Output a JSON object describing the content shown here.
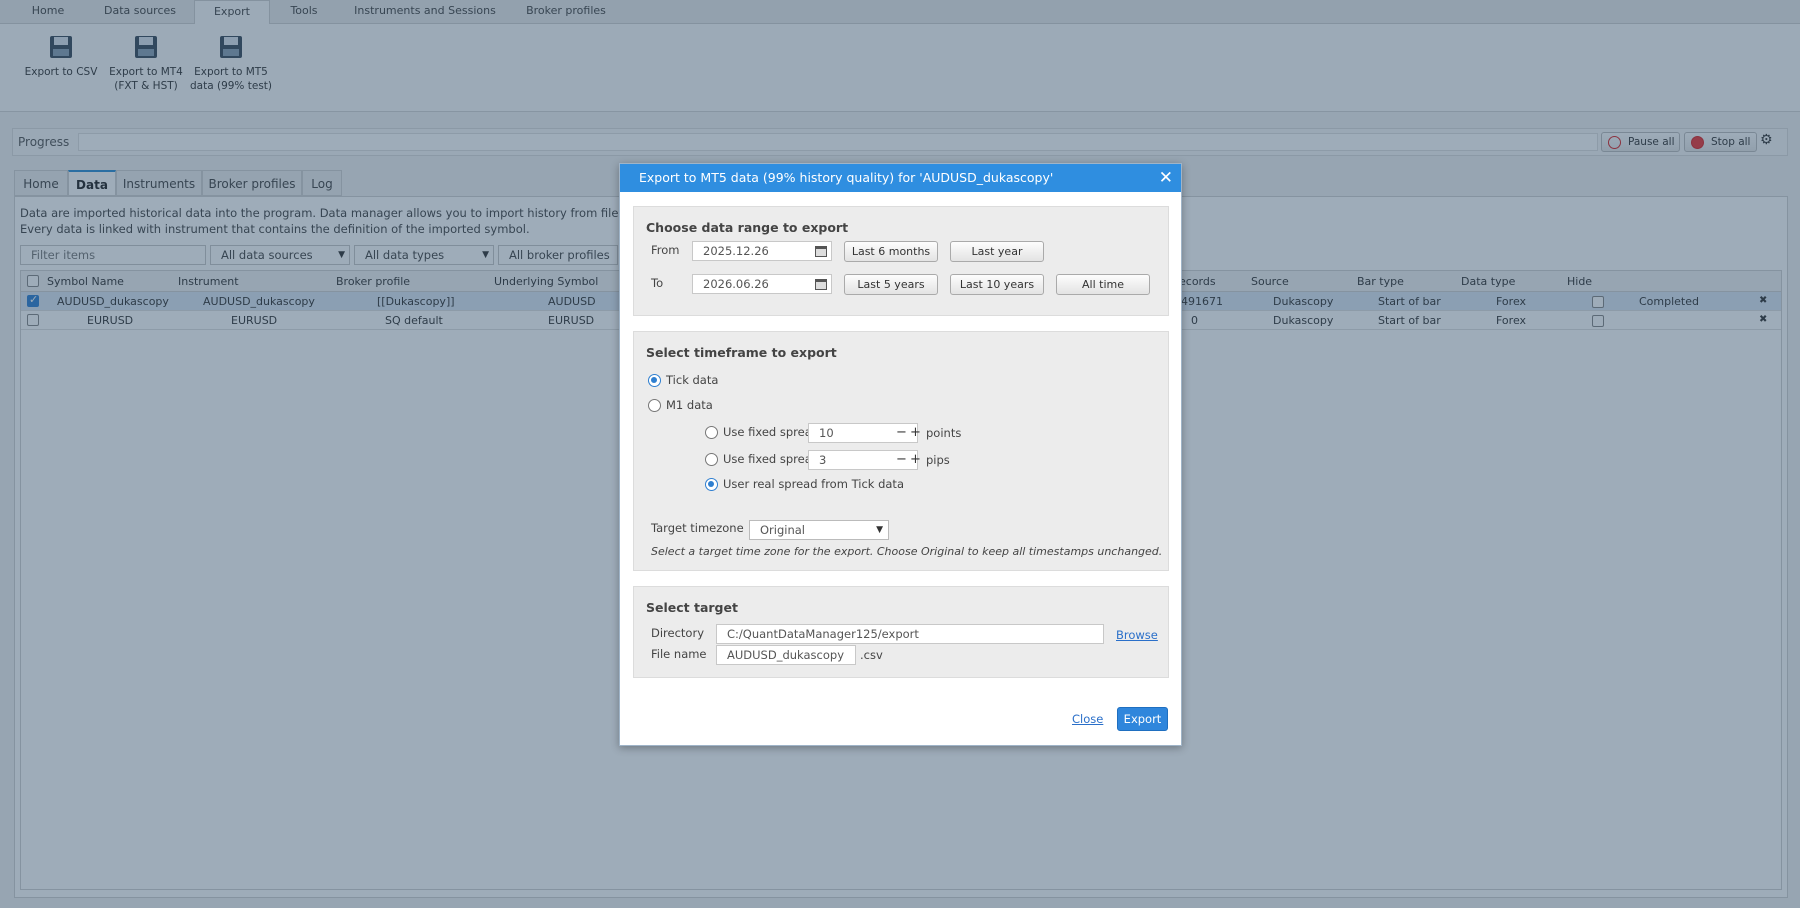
{
  "top_tabs": [
    "Home",
    "Data sources",
    "Export",
    "Tools",
    "Instruments and Sessions",
    "Broker profiles"
  ],
  "ribbon": {
    "csv": "Export to CSV",
    "mt4_line1": "Export to MT4",
    "mt4_line2": "(FXT & HST)",
    "mt5_line1": "Export to MT5",
    "mt5_line2": "data (99% test)"
  },
  "progress": {
    "label": "Progress",
    "pause": "Pause all",
    "stop": "Stop all"
  },
  "inner_tabs": [
    "Home",
    "Data",
    "Instruments",
    "Broker profiles",
    "Log"
  ],
  "description": {
    "line1": "Data are imported historical data into the program. Data manager allows you to import history from files, or to do",
    "line2": "Every data is linked with instrument that contains the definition of the imported symbol."
  },
  "filters": {
    "search_placeholder": "Filter items",
    "sources": "All data sources",
    "types": "All data types",
    "brokers": "All broker profiles"
  },
  "table": {
    "headers": [
      "Symbol Name",
      "Instrument",
      "Broker profile",
      "Underlying Symbol",
      "ecords",
      "Source",
      "Bar type",
      "Data type",
      "Hide"
    ],
    "rows": [
      {
        "symbol": "AUDUSD_dukascopy",
        "instrument": "AUDUSD_dukascopy",
        "broker": "[[Dukascopy]]",
        "underlying": "AUDUSD",
        "records": "491671",
        "source": "Dukascopy",
        "bar_type": "Start of bar",
        "data_type": "Forex",
        "status": "Completed",
        "checked": true
      },
      {
        "symbol": "EURUSD",
        "instrument": "EURUSD",
        "broker": "SQ default",
        "underlying": "EURUSD",
        "records": "0",
        "source": "Dukascopy",
        "bar_type": "Start of bar",
        "data_type": "Forex",
        "status": "",
        "checked": false
      }
    ]
  },
  "dialog": {
    "title": "Export to MT5 data (99% history quality) for 'AUDUSD_dukascopy'",
    "range": {
      "heading": "Choose data range to export",
      "from_label": "From",
      "from_value": "2025.12.26",
      "to_label": "To",
      "to_value": "2026.06.26",
      "btn_6m": "Last 6 months",
      "btn_1y": "Last year",
      "btn_5y": "Last 5 years",
      "btn_10y": "Last 10 years",
      "btn_all": "All time"
    },
    "timeframe": {
      "heading": "Select timeframe to export",
      "tick": "Tick data",
      "m1": "M1 data",
      "fixed_label": "Use fixed spread",
      "fixed_points_value": "10",
      "points": "points",
      "fixed_pips_value": "3",
      "pips": "pips",
      "real_spread": "User real spread from Tick data",
      "tz_label": "Target timezone",
      "tz_value": "Original",
      "tz_hint": "Select a target time zone for the export. Choose Original to keep all timestamps unchanged."
    },
    "target": {
      "heading": "Select target",
      "dir_label": "Directory",
      "dir_value": "C:/QuantDataManager125/export",
      "browse": "Browse",
      "file_label": "File name",
      "file_value": "AUDUSD_dukascopy",
      "ext": ".csv"
    },
    "close": "Close",
    "export": "Export"
  },
  "colors": {
    "accent": "#2f8ee0",
    "stop": "#dd2222"
  }
}
